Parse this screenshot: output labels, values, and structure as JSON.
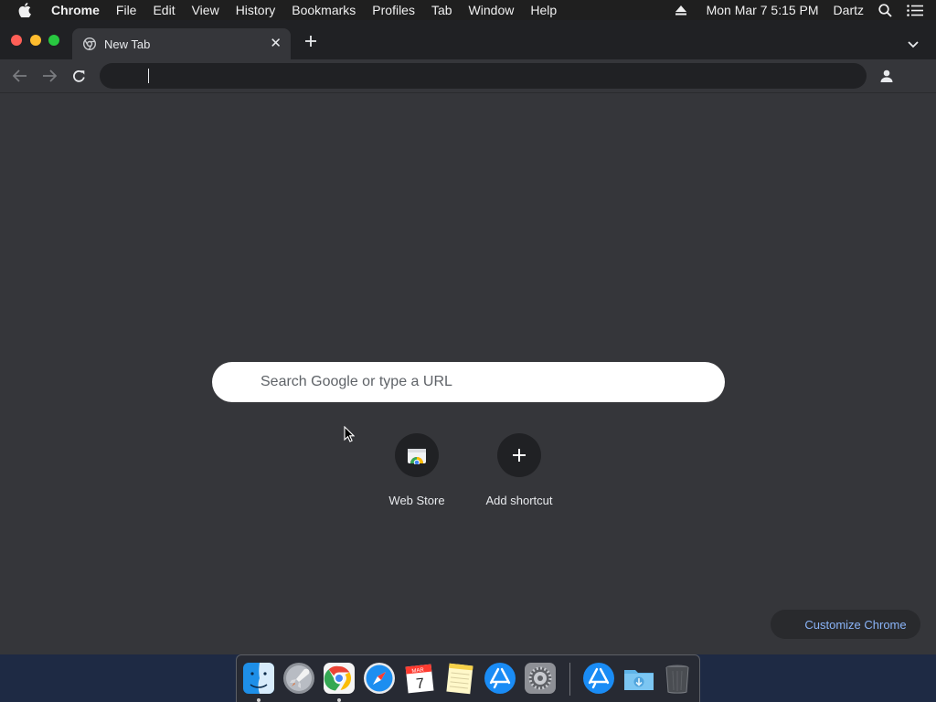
{
  "menubar": {
    "app_name": "Chrome",
    "items": [
      "File",
      "Edit",
      "View",
      "History",
      "Bookmarks",
      "Profiles",
      "Tab",
      "Window",
      "Help"
    ],
    "datetime": "Mon Mar 7  5:15 PM",
    "user": "Dartz"
  },
  "browser": {
    "tab": {
      "title": "New Tab"
    },
    "omnibox": {
      "value": ""
    }
  },
  "ntp": {
    "search_placeholder": "Search Google or type a URL",
    "shortcuts": [
      {
        "label": "Web Store",
        "icon": "web-store-icon"
      },
      {
        "label": "Add shortcut",
        "icon": "plus-icon"
      }
    ],
    "customize_label": "Customize Chrome"
  },
  "dock": {
    "apps": [
      "Finder",
      "Launchpad",
      "Google Chrome",
      "Safari",
      "Calendar",
      "Notes",
      "App Store",
      "System Preferences",
      "App Store",
      "Downloads",
      "Trash"
    ],
    "calendar": {
      "month": "MAR",
      "day": "7"
    },
    "running": [
      "Finder",
      "Google Chrome"
    ]
  },
  "colors": {
    "window_bg": "#35363a",
    "tabstrip_bg": "#202124",
    "accent_link": "#8ab4f8",
    "desktop_bg": "#1e2a44"
  }
}
